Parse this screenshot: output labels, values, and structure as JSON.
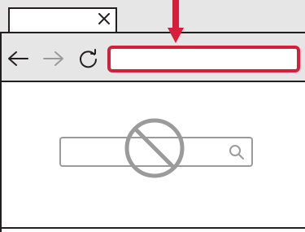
{
  "browser": {
    "tab": {
      "title": "",
      "close_icon": "close-icon"
    },
    "toolbar": {
      "back_icon": "back-arrow-icon",
      "forward_icon": "forward-arrow-icon",
      "reload_icon": "reload-icon",
      "address_bar": {
        "value": "",
        "highlight_color": "#d71f3c"
      }
    },
    "content": {
      "search": {
        "value": "",
        "placeholder": "",
        "icon": "search-icon"
      },
      "overlay_icon": "prohibited-icon"
    }
  },
  "colors": {
    "chrome": "#e6e6e6",
    "line": "#231f20",
    "highlight": "#d71f3c",
    "disabled": "#9b9b9b"
  }
}
